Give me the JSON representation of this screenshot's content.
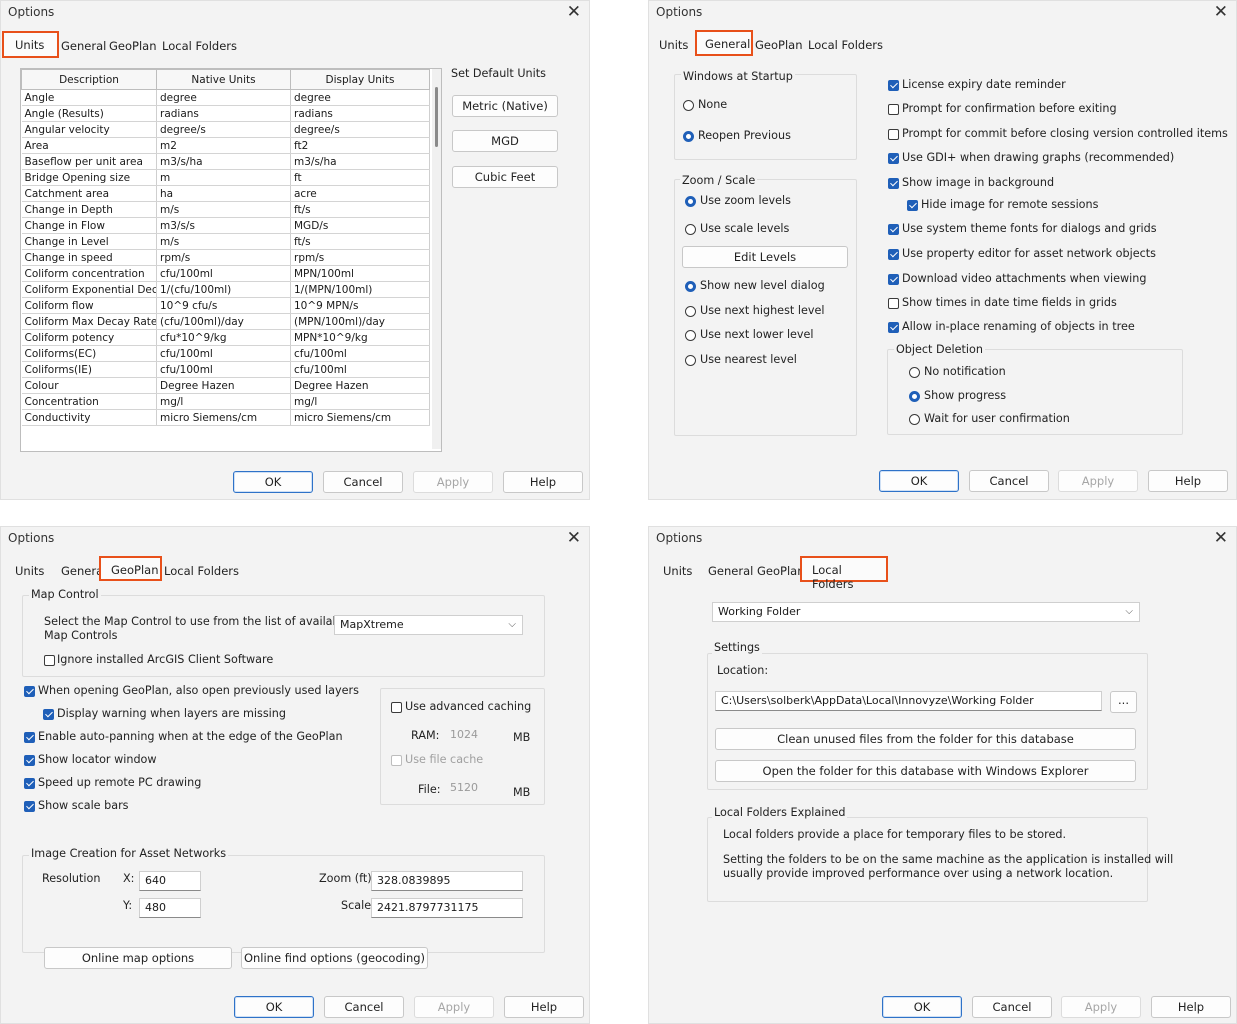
{
  "dialog_title": "Options",
  "tabs": {
    "units": "Units",
    "general": "General",
    "geoplan": "GeoPlan",
    "local_folders": "Local Folders"
  },
  "footer": {
    "ok": "OK",
    "cancel": "Cancel",
    "apply": "Apply",
    "help": "Help"
  },
  "units_panel": {
    "columns": [
      "Description",
      "Native Units",
      "Display Units"
    ],
    "rows": [
      [
        "Angle",
        "degree",
        "degree"
      ],
      [
        "Angle (Results)",
        "radians",
        "radians"
      ],
      [
        "Angular velocity",
        "degree/s",
        "degree/s"
      ],
      [
        "Area",
        "m2",
        "ft2"
      ],
      [
        "Baseflow per unit area",
        "m3/s/ha",
        "m3/s/ha"
      ],
      [
        "Bridge Opening size",
        "m",
        "ft"
      ],
      [
        "Catchment area",
        "ha",
        "acre"
      ],
      [
        "Change in Depth",
        "m/s",
        "ft/s"
      ],
      [
        "Change in Flow",
        "m3/s/s",
        "MGD/s"
      ],
      [
        "Change in Level",
        "m/s",
        "ft/s"
      ],
      [
        "Change in speed",
        "rpm/s",
        "rpm/s"
      ],
      [
        "Coliform concentration",
        "cfu/100ml",
        "MPN/100ml"
      ],
      [
        "Coliform Exponential Deca",
        "1/(cfu/100ml)",
        "1/(MPN/100ml)"
      ],
      [
        "Coliform flow",
        "10^9 cfu/s",
        "10^9 MPN/s"
      ],
      [
        "Coliform Max Decay Rate",
        "(cfu/100ml)/day",
        "(MPN/100ml)/day"
      ],
      [
        "Coliform potency",
        "cfu*10^9/kg",
        "MPN*10^9/kg"
      ],
      [
        "Coliforms(EC)",
        "cfu/100ml",
        "cfu/100ml"
      ],
      [
        "Coliforms(IE)",
        "cfu/100ml",
        "cfu/100ml"
      ],
      [
        "Colour",
        "Degree Hazen",
        "Degree Hazen"
      ],
      [
        "Concentration",
        "mg/l",
        "mg/l"
      ],
      [
        "Conductivity",
        "micro Siemens/cm",
        "micro Siemens/cm"
      ]
    ],
    "set_default_units": "Set Default Units",
    "metric_button": "Metric (Native)",
    "mgd_button": "MGD",
    "cubic_feet_button": "Cubic Feet"
  },
  "general_panel": {
    "windows_at_startup": "Windows at Startup",
    "none": "None",
    "reopen_previous": "Reopen Previous",
    "zoom_scale": "Zoom / Scale",
    "use_zoom_levels": "Use zoom levels",
    "use_scale_levels": "Use scale levels",
    "edit_levels": "Edit Levels",
    "show_new_level_dialog": "Show new level dialog",
    "use_next_highest": "Use next highest level",
    "use_next_lower": "Use next lower level",
    "use_nearest": "Use nearest level",
    "options": [
      {
        "label": "License expiry date reminder",
        "checked": true
      },
      {
        "label": "Prompt for confirmation before exiting",
        "checked": false
      },
      {
        "label": "Prompt for commit before closing version controlled items",
        "checked": false
      },
      {
        "label": "Use GDI+ when drawing graphs (recommended)",
        "checked": true
      },
      {
        "label": "Show image in background",
        "checked": true
      },
      {
        "label": "Hide image for remote sessions",
        "checked": true
      },
      {
        "label": "Use system theme fonts for dialogs and grids",
        "checked": true
      },
      {
        "label": "Use property editor for asset network objects",
        "checked": true
      },
      {
        "label": "Download video attachments when viewing",
        "checked": true
      },
      {
        "label": "Show times in date time fields in grids",
        "checked": false
      },
      {
        "label": "Allow in-place renaming of objects in tree",
        "checked": true
      }
    ],
    "object_deletion": "Object Deletion",
    "no_notification": "No notification",
    "show_progress": "Show progress",
    "wait_for_user": "Wait for user confirmation"
  },
  "geoplan_panel": {
    "map_control": "Map Control",
    "select_text_line1": "Select the Map Control to use from the list of available",
    "select_text_line2": "Map Controls",
    "map_control_value": "MapXtreme",
    "ignore_arcgis": "Ignore installed ArcGIS Client Software",
    "when_opening": "When opening GeoPlan, also open previously used layers",
    "display_warning": "Display warning when layers are missing",
    "auto_panning": "Enable auto-panning when at the edge of the GeoPlan",
    "show_locator": "Show locator window",
    "speed_up": "Speed up remote PC drawing",
    "show_scale_bars": "Show scale bars",
    "use_advanced_caching": "Use advanced caching",
    "ram_label": "RAM:",
    "ram_value": "1024",
    "mb1": "MB",
    "use_file_cache": "Use file cache",
    "file_label": "File:",
    "file_value": "5120",
    "mb2": "MB",
    "image_creation": "Image Creation for Asset Networks",
    "resolution": "Resolution",
    "x_label": "X:",
    "x_value": "640",
    "y_label": "Y:",
    "y_value": "480",
    "zoom_label": "Zoom (ft):",
    "zoom_value": "328.0839895",
    "scale_label": "Scale:",
    "scale_value": "2421.8797731175",
    "online_map_options": "Online map options",
    "online_find_options": "Online find options (geocoding)"
  },
  "local_folders_panel": {
    "folder_select": "Working Folder",
    "settings": "Settings",
    "location_label": "Location:",
    "location_value": "C:\\Users\\solberk\\AppData\\Local\\Innovyze\\Working Folder",
    "browse": "...",
    "clean_unused": "Clean unused files from the folder for this database",
    "open_folder": "Open the folder for this database with Windows Explorer",
    "explained_title": "Local Folders Explained",
    "explained_p1": "Local folders provide a place for temporary files to be stored.",
    "explained_p2_line1": "Setting the folders to be on the same machine as the application is installed will",
    "explained_p2_line2": "usually provide improved performance over using a network location."
  },
  "colors": {
    "highlight": "#e8501a",
    "accent": "#1f5fb8"
  }
}
